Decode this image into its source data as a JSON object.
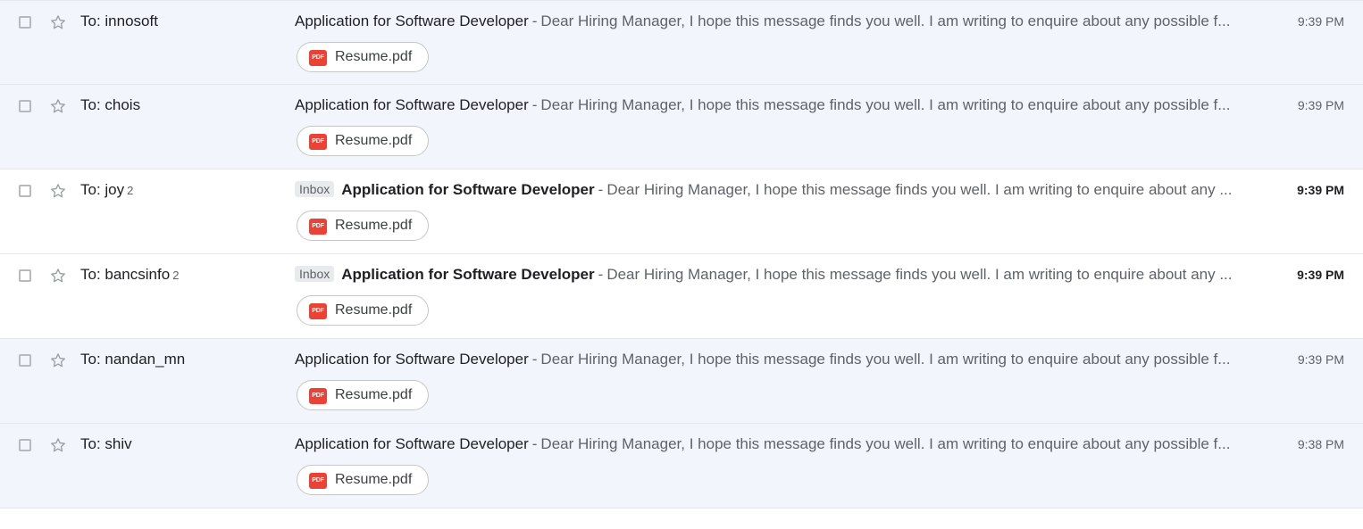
{
  "rows": [
    {
      "read": true,
      "sender": "To: innosoft",
      "count": "",
      "label": "",
      "subject": "Application for Software Developer",
      "separator": "-",
      "snippet": "Dear Hiring Manager, I hope this message finds you well. I am writing to enquire about any possible f...",
      "time": "9:39 PM",
      "attachment": "Resume.pdf",
      "attachment_icon": "PDF"
    },
    {
      "read": true,
      "sender": "To: chois",
      "count": "",
      "label": "",
      "subject": "Application for Software Developer",
      "separator": "-",
      "snippet": "Dear Hiring Manager, I hope this message finds you well. I am writing to enquire about any possible f...",
      "time": "9:39 PM",
      "attachment": "Resume.pdf",
      "attachment_icon": "PDF"
    },
    {
      "read": false,
      "sender": "To: joy",
      "count": "2",
      "label": "Inbox",
      "subject": "Application for Software Developer",
      "separator": "-",
      "snippet": "Dear Hiring Manager, I hope this message finds you well. I am writing to enquire about any ...",
      "time": "9:39 PM",
      "attachment": "Resume.pdf",
      "attachment_icon": "PDF"
    },
    {
      "read": false,
      "sender": "To: bancsinfo",
      "count": "2",
      "label": "Inbox",
      "subject": "Application for Software Developer",
      "separator": "-",
      "snippet": "Dear Hiring Manager, I hope this message finds you well. I am writing to enquire about any ...",
      "time": "9:39 PM",
      "attachment": "Resume.pdf",
      "attachment_icon": "PDF"
    },
    {
      "read": true,
      "sender": "To: nandan_mn",
      "count": "",
      "label": "",
      "subject": "Application for Software Developer",
      "separator": "-",
      "snippet": "Dear Hiring Manager, I hope this message finds you well. I am writing to enquire about any possible f...",
      "time": "9:39 PM",
      "attachment": "Resume.pdf",
      "attachment_icon": "PDF"
    },
    {
      "read": true,
      "sender": "To: shiv",
      "count": "",
      "label": "",
      "subject": "Application for Software Developer",
      "separator": "-",
      "snippet": "Dear Hiring Manager, I hope this message finds you well. I am writing to enquire about any possible f...",
      "time": "9:38 PM",
      "attachment": "Resume.pdf",
      "attachment_icon": "PDF"
    }
  ],
  "colors": {
    "read_row_bg": "#f2f6fc",
    "unread_row_bg": "#ffffff",
    "pdf_red": "#ea4335"
  },
  "icons": {
    "checkbox": "checkbox-icon",
    "star": "star-icon",
    "attachment": "pdf-icon"
  }
}
